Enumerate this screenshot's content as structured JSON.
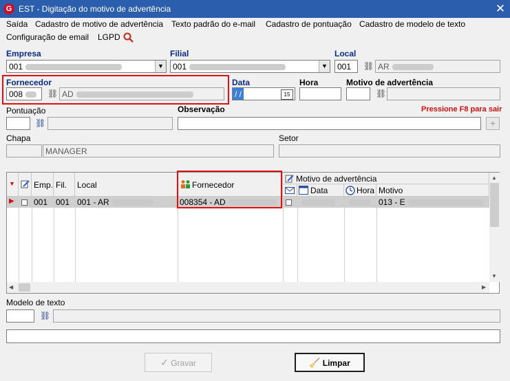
{
  "window": {
    "title": "EST - Digitação do motivo de advertência",
    "logo": "G",
    "close_glyph": "✕"
  },
  "menu": {
    "items": [
      "Saída",
      "Cadastro de motivo de advertência",
      "Texto padrão do e-mail",
      "Cadastro de pontuação",
      "Cadastro de modelo de texto",
      "Configuração de email",
      "LGPD"
    ]
  },
  "fields": {
    "empresa": {
      "label": "Empresa",
      "value": "001"
    },
    "filial": {
      "label": "Filial",
      "value": "001"
    },
    "local": {
      "label": "Local",
      "code": "001",
      "desc": "AR"
    },
    "fornecedor": {
      "label": "Fornecedor",
      "code": "008",
      "desc": "AD"
    },
    "data": {
      "label": "Data",
      "value": " / /",
      "cal": "15"
    },
    "hora": {
      "label": "Hora",
      "value": ""
    },
    "motivo": {
      "label": "Motivo de advertência",
      "value": ""
    },
    "pontuacao": {
      "label": "Pontuação",
      "value": ""
    },
    "observacao": {
      "label": "Observação",
      "value": ""
    },
    "hint": "Pressione F8 para sair",
    "chapa": {
      "label": "Chapa",
      "value": "",
      "desc": "MANAGER"
    },
    "setor": {
      "label": "Setor",
      "value": ""
    },
    "modelo_texto": {
      "label": "Modelo de texto",
      "value": ""
    },
    "obs_footer": {
      "value": ""
    }
  },
  "grid": {
    "group_header": "Motivo de advertência",
    "columns": [
      "Emp.",
      "Fil.",
      "Local",
      "Fornecedor",
      "Data",
      "Hora",
      "Motivo"
    ],
    "rows": [
      {
        "emp": "001",
        "fil": "001",
        "local": "001 - AR",
        "fornecedor": "008354 - AD",
        "data": "",
        "hora": "",
        "motivo": "013 - E"
      }
    ]
  },
  "buttons": {
    "gravar": "Gravar",
    "limpar": "Limpar"
  },
  "colors": {
    "titlebar": "#2b5fad",
    "highlight": "#e01010",
    "label_blue": "#0a2a8a"
  }
}
